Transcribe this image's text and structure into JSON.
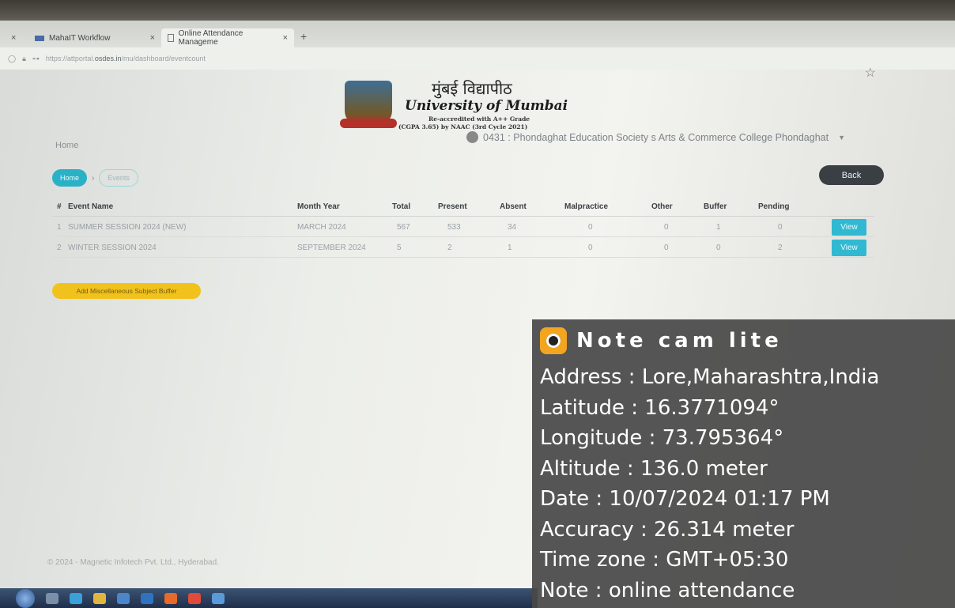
{
  "browser": {
    "tabs": [
      {
        "label": ""
      },
      {
        "label": "MahaIT Workflow"
      },
      {
        "label": "Online Attendance Manageme"
      }
    ],
    "url_prefix": "https://attportal.",
    "url_domain": "osdes.in",
    "url_path": "/mu/dashboard/eventcount"
  },
  "header": {
    "hindi_name": "मुंबई विद्यापीठ",
    "english_name": "University of Mumbai",
    "accreditation_line1": "Re-accredited with A++ Grade",
    "accreditation_line2": "(CGPA 3.65) by NAAC (3rd Cycle 2021)"
  },
  "page": {
    "title": "Home",
    "college": "0431 : Phondaghat Education Society s Arts & Commerce College Phondaghat"
  },
  "breadcrumb": {
    "home": "Home",
    "events": "Events"
  },
  "back_label": "Back",
  "table": {
    "headers": {
      "no": "#",
      "name": "Event Name",
      "month": "Month Year",
      "total": "Total",
      "present": "Present",
      "absent": "Absent",
      "malpractice": "Malpractice",
      "other": "Other",
      "buffer": "Buffer",
      "pending": "Pending"
    },
    "rows": [
      {
        "no": "1",
        "name": "SUMMER SESSION 2024 (NEW)",
        "month": "MARCH 2024",
        "total": "567",
        "present": "533",
        "absent": "34",
        "malpractice": "0",
        "other": "0",
        "buffer": "1",
        "pending": "0",
        "action": "View"
      },
      {
        "no": "2",
        "name": "WINTER SESSION 2024",
        "month": "SEPTEMBER 2024",
        "total": "5",
        "present": "2",
        "absent": "1",
        "malpractice": "0",
        "other": "0",
        "buffer": "0",
        "pending": "2",
        "action": "View"
      }
    ]
  },
  "misc_button": "Add Miscellaneous Subject Buffer",
  "footer": "© 2024 - Magnetic Infotech Pvt. Ltd., Hyderabad.",
  "notecam": {
    "title": "Note cam lite",
    "address": "Address : Lore,Maharashtra,India",
    "latitude": "Latitude : 16.3771094°",
    "longitude": "Longitude : 73.795364°",
    "altitude": "Altitude : 136.0 meter",
    "date": "Date : 10/07/2024 01:17 PM",
    "accuracy": "Accuracy : 26.314 meter",
    "timezone": "Time zone : GMT+05:30",
    "note": "Note : online attendance"
  },
  "colors": {
    "accent": "#2bb1c5",
    "view_button": "#30b9d1",
    "back_button": "#3a3f44",
    "misc_button": "#f2c21c"
  }
}
